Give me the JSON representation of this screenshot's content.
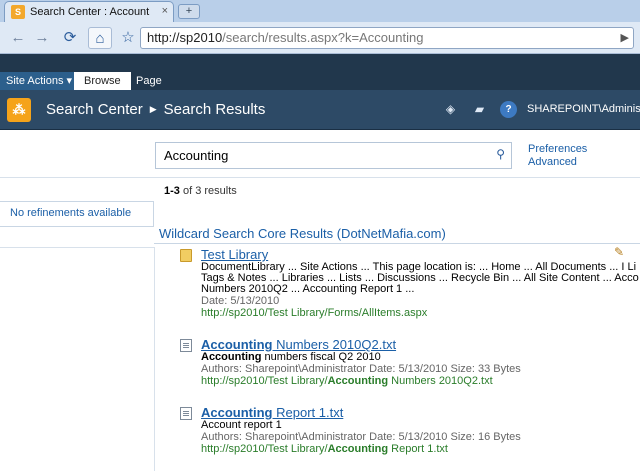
{
  "browser": {
    "tab_title": "Search Center : Accountin...",
    "tab_close": "×",
    "new_tab": "+",
    "url_host": "http://sp2010",
    "url_path": "/search/results.aspx?k=Accounting"
  },
  "ribbon": {
    "site_actions": "Site Actions ▾",
    "tabs": [
      "Browse",
      "Page"
    ]
  },
  "title_bar": {
    "site": "Search Center",
    "separator": "▶",
    "page": "Search Results",
    "user": "SHAREPOINT\\Administ"
  },
  "search": {
    "query": "Accounting",
    "links": [
      "Preferences",
      "Advanced"
    ]
  },
  "result_count": {
    "range": "1-3",
    "text": " of 3 results"
  },
  "refinement": "No refinements available",
  "webpart_title": "Wildcard Search Core Results (DotNetMafia.com)",
  "results": [
    {
      "title": "Test Library",
      "lines": [
        "DocumentLibrary ... Site Actions ... This page location is: ... Home ... All Documents ... I Li",
        "Tags & Notes ... Libraries ... Lists ... Discussions ... Recycle Bin ... All Site Content ... Acco",
        "Numbers 2010Q2 ... Accounting Report 1 ..."
      ],
      "meta": "Date: 5/13/2010",
      "url": "http://sp2010/Test Library/Forms/AllItems.aspx"
    },
    {
      "title_bold": "Accounting",
      "title_rest": " Numbers 2010Q2.txt",
      "summary_bold": "Accounting",
      "summary_rest": " numbers fiscal Q2 2010",
      "meta": "Authors: Sharepoint\\Administrator   Date: 5/13/2010   Size: 33 Bytes",
      "url_pre": "http://sp2010/Test Library/",
      "url_bold": "Accounting",
      "url_post": " Numbers 2010Q2.txt"
    },
    {
      "title_bold": "Accounting",
      "title_rest": " Report 1.txt",
      "summary": "Account report 1",
      "meta": "Authors: Sharepoint\\Administrator   Date: 5/13/2010   Size: 16 Bytes",
      "url_pre": "http://sp2010/Test Library/",
      "url_bold": "Accounting",
      "url_post": " Report 1.txt"
    }
  ]
}
